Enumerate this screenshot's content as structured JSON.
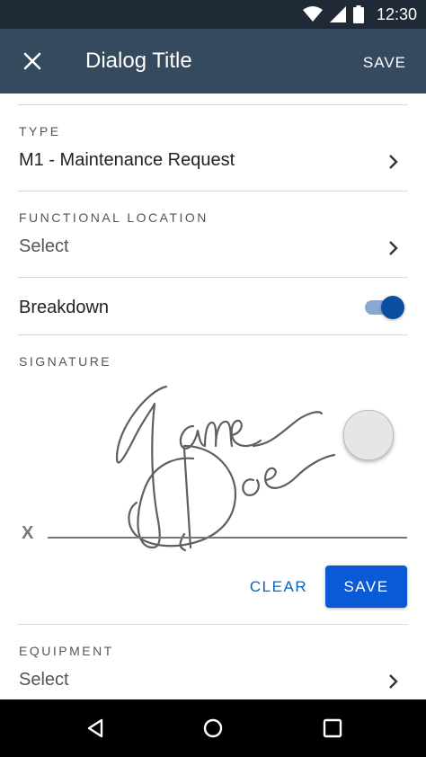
{
  "status_bar": {
    "time": "12:30",
    "icons": [
      "wifi-icon",
      "cell-signal-icon",
      "battery-icon"
    ]
  },
  "app_bar": {
    "title": "Dialog Title",
    "save_label": "SAVE",
    "close_icon": "close-icon"
  },
  "fields": {
    "type": {
      "label": "TYPE",
      "value": "M1 - Maintenance Request"
    },
    "functional_location": {
      "label": "FUNCTIONAL LOCATION",
      "value": "Select"
    },
    "breakdown": {
      "label": "Breakdown",
      "enabled": true
    },
    "signature": {
      "label": "SIGNATURE",
      "x_mark": "X",
      "clear_label": "CLEAR",
      "save_label": "SAVE"
    },
    "equipment": {
      "label": "EQUIPMENT",
      "value": "Select"
    }
  },
  "nav_bar": {
    "icons": [
      "back-icon",
      "home-icon",
      "recents-icon"
    ]
  },
  "colors": {
    "status_bar": "#1f2a36",
    "app_bar": "#354a5f",
    "accent": "#0a5ad6",
    "toggle_knob": "#0a4ea2",
    "toggle_track": "#89a9d3"
  }
}
